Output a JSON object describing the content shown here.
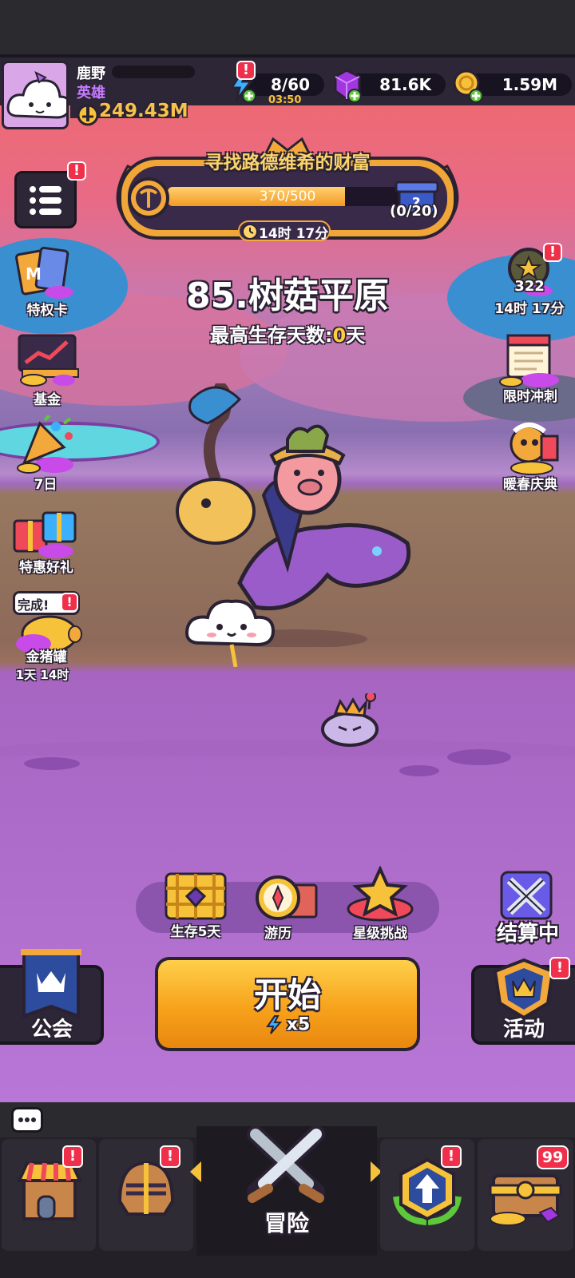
{
  "player": {
    "name": "鹿野",
    "rank": "英雄",
    "power": "249.43M"
  },
  "resources": {
    "energy": "8/60",
    "energy_timer": "03:50",
    "gems": "81.6K",
    "coins": "1.59M"
  },
  "event_banner": {
    "title": "寻找路德维希的财富",
    "progress_text": "370/500",
    "progress_fraction": 0.74,
    "reward_count": "(0/20)",
    "timer": "14时 17分"
  },
  "stage": {
    "title": "85.树菇平原",
    "best_label": "最高生存天数:",
    "best_value": "0",
    "best_unit": "天"
  },
  "left_menu": {
    "privilege_card": "特权卡",
    "fund": "基金",
    "seven_day": "7日",
    "special_gift": "特惠好礼",
    "piggy_done": "完成!",
    "piggy_bank": "金猪罐",
    "piggy_timer": "1天 14时"
  },
  "right_menu": {
    "pass_count": "322",
    "pass_timer": "14时 17分",
    "limited_sprint": "限时冲刺",
    "spring_festival": "暖春庆典"
  },
  "modes": {
    "survive": "生存5天",
    "travel": "游历",
    "star_challenge": "星级挑战",
    "settling": "结算中"
  },
  "actions": {
    "guild": "公会",
    "start": "开始",
    "cost": "x5",
    "events": "活动"
  },
  "nav": {
    "adventure": "冒险",
    "chest_badge": "99"
  },
  "colors": {
    "accent_orange": "#f7a21b",
    "badge_red": "#f0304a",
    "gold": "#f6c23a",
    "purple_gem": "#a236e0"
  }
}
